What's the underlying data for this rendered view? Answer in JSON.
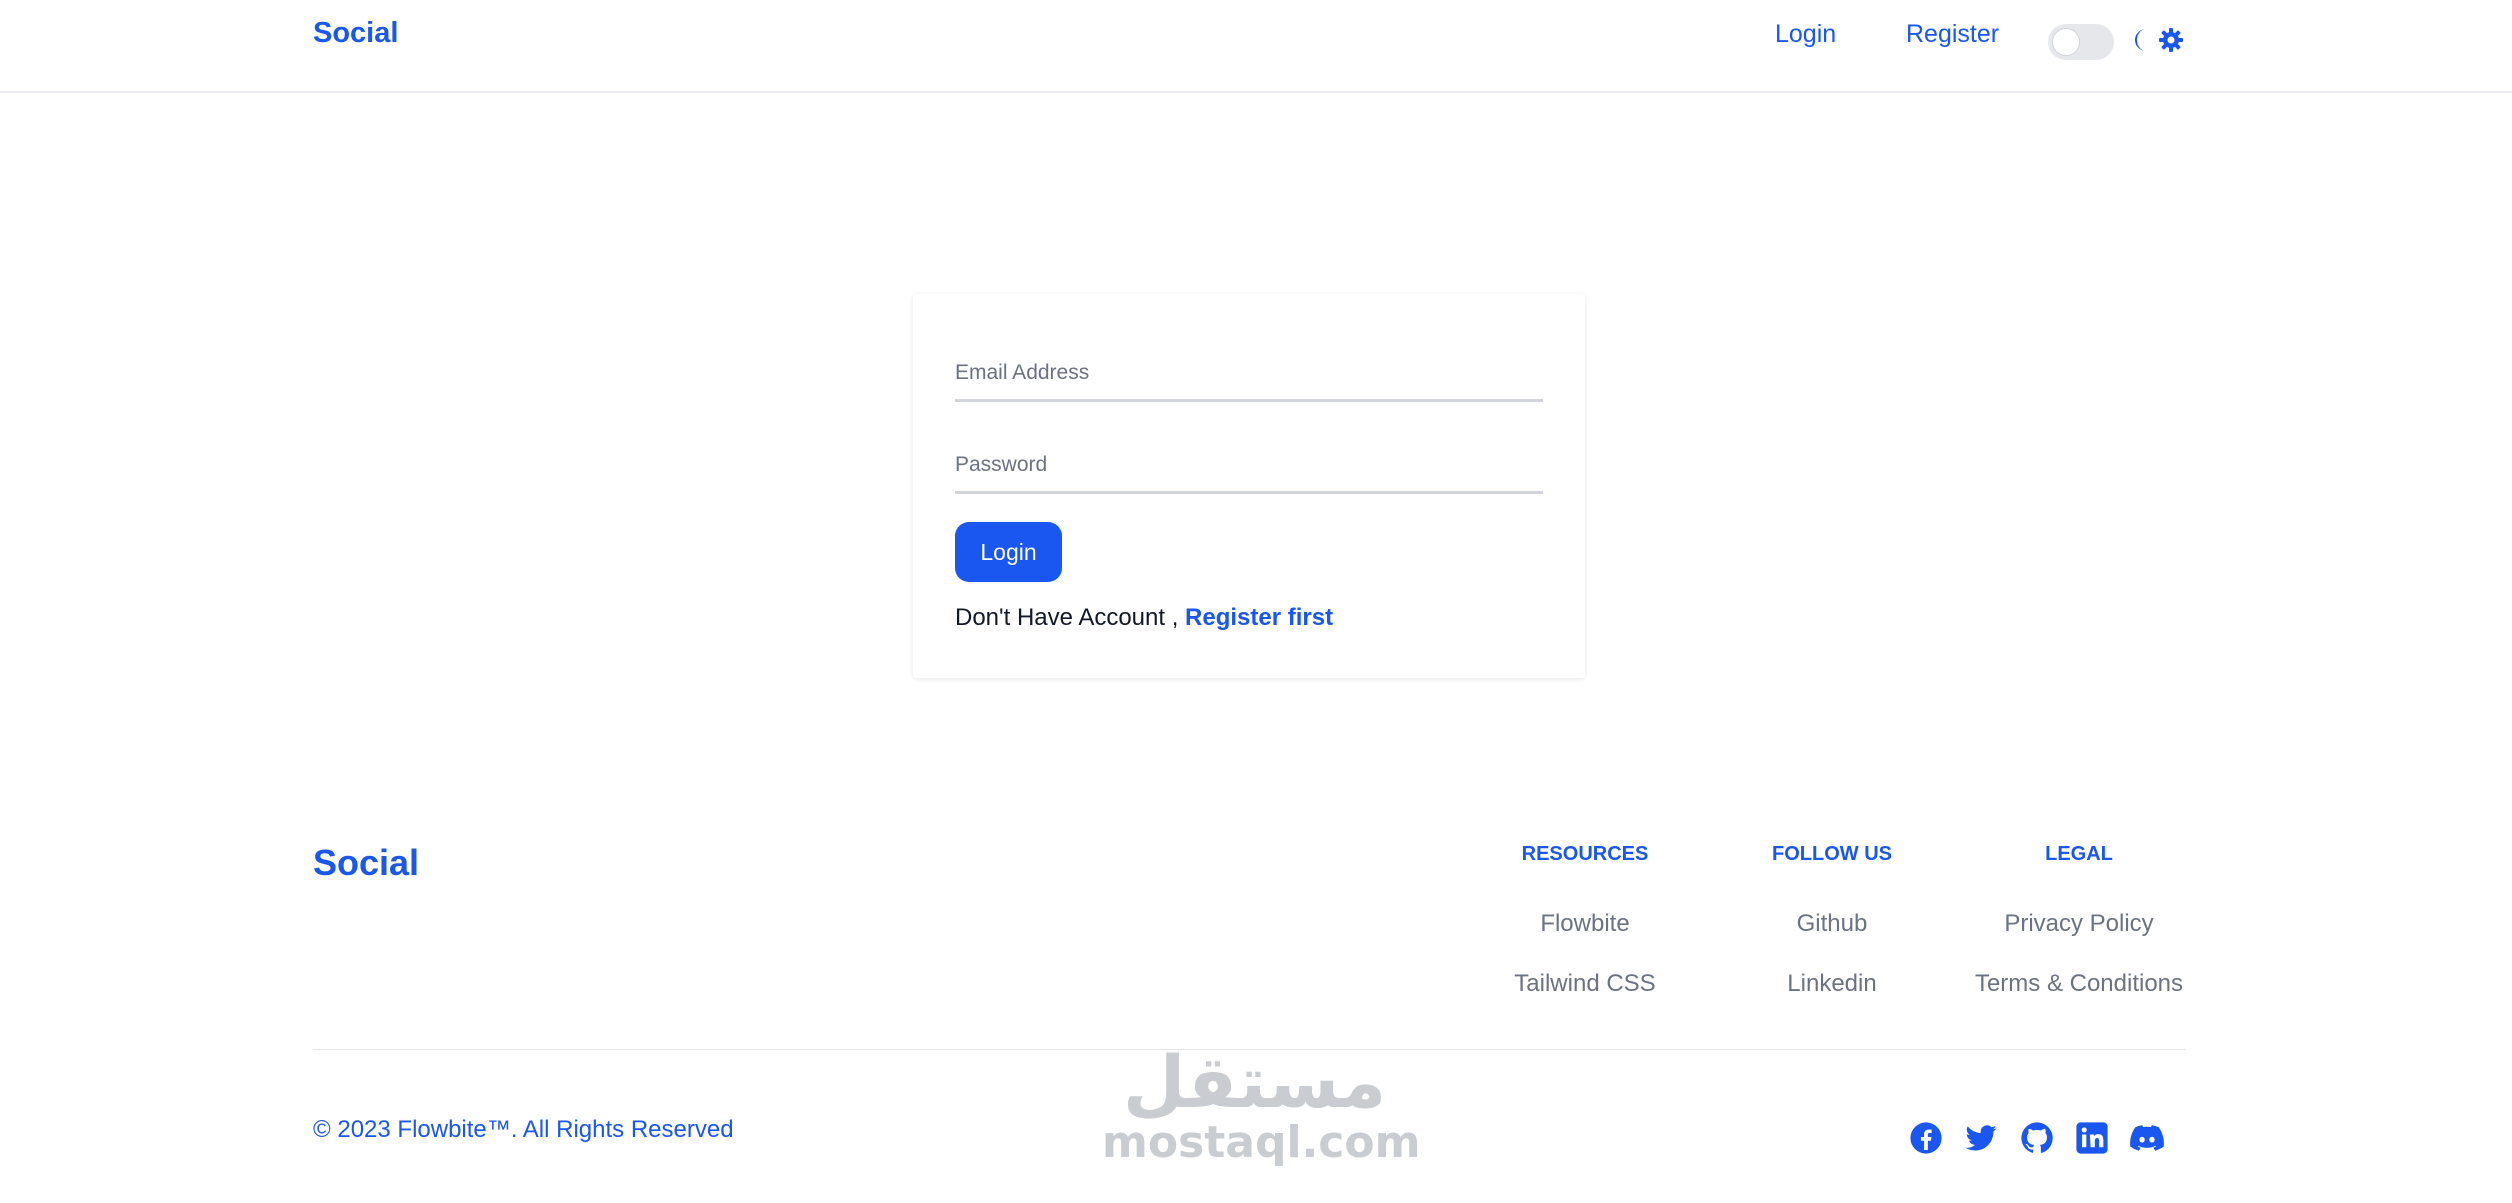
{
  "header": {
    "brand": "Social",
    "nav": {
      "login": "Login",
      "register": "Register"
    },
    "theme_toggle": {
      "enabled": false,
      "icons": [
        "moon-icon",
        "sun-icon"
      ]
    }
  },
  "login_form": {
    "email_placeholder": "Email Address",
    "password_placeholder": "Password",
    "submit_label": "Login",
    "no_account_text": "Don't Have Account ,",
    "register_link": "Register first"
  },
  "footer": {
    "brand": "Social",
    "columns": [
      {
        "title": "RESOURCES",
        "links": [
          "Flowbite",
          "Tailwind CSS"
        ]
      },
      {
        "title": "FOLLOW US",
        "links": [
          "Github",
          "Linkedin"
        ]
      },
      {
        "title": "LEGAL",
        "links": [
          "Privacy Policy",
          "Terms & Conditions"
        ]
      }
    ],
    "copyright": "© 2023 Flowbite™. All Rights Reserved",
    "social_icons": [
      "facebook-icon",
      "twitter-icon",
      "github-icon",
      "linkedin-icon",
      "discord-icon"
    ]
  },
  "watermark": {
    "arabic": "مستقل",
    "latin": "mostaql.com"
  },
  "colors": {
    "accent": "#1a56f0",
    "muted": "#6b7280",
    "border": "#d1d5db"
  }
}
